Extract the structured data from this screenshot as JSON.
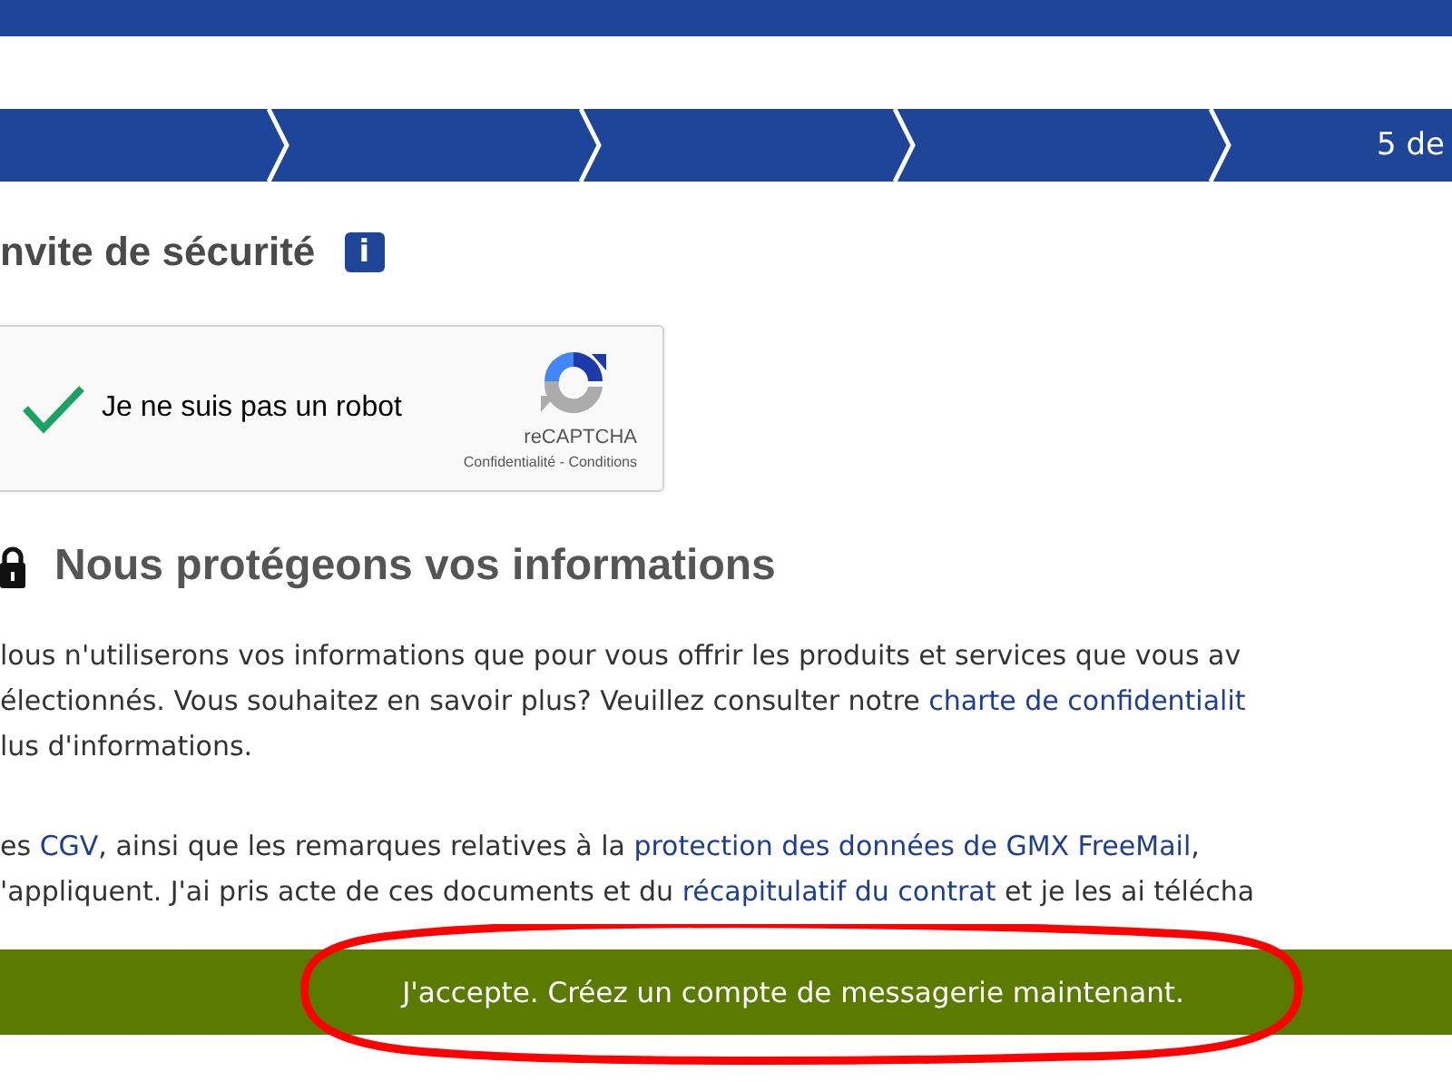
{
  "progress": {
    "step_label": "5 de"
  },
  "security": {
    "title": "nvite de sécurité",
    "info_icon": "i"
  },
  "captcha": {
    "checked": true,
    "label": "Je ne suis pas un robot",
    "brand": "reCAPTCHA",
    "links": "Confidentialité - Conditions"
  },
  "privacy": {
    "title": "Nous protégeons vos informations",
    "lines": [
      [
        {
          "text": "lous n'utiliserons vos informations que pour vous offrir les produits et services que vous av",
          "link": false
        }
      ],
      [
        {
          "text": "électionnés. Vous souhaitez en savoir plus? Veuillez consulter notre ",
          "link": false
        },
        {
          "text": "charte de confidentialit",
          "link": true
        }
      ],
      [
        {
          "text": "lus d'informations.",
          "link": false
        }
      ]
    ]
  },
  "terms": {
    "lines": [
      [
        {
          "text": "es ",
          "link": false
        },
        {
          "text": "CGV",
          "link": true
        },
        {
          "text": ", ainsi que les remarques relatives à la ",
          "link": false
        },
        {
          "text": "protection des données de GMX FreeMail",
          "link": true
        },
        {
          "text": ",",
          "link": false
        }
      ],
      [
        {
          "text": "'appliquent. J'ai pris acte de ces documents et du ",
          "link": false
        },
        {
          "text": "récapitulatif du contrat",
          "link": true
        },
        {
          "text": " et je les ai télécha",
          "link": false
        }
      ]
    ]
  },
  "accept_button": {
    "label": "J'accepte. Créez un compte de messagerie maintenant."
  }
}
